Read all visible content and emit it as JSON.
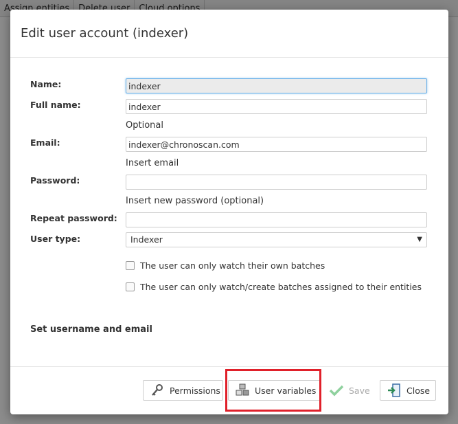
{
  "background": {
    "toolbar": [
      "Assign entities",
      "Delete user",
      "Cloud options"
    ]
  },
  "dialog": {
    "title": "Edit user account (indexer)",
    "fields": {
      "name_label": "Name:",
      "name_value": "indexer",
      "fullname_label": "Full name:",
      "fullname_value": "indexer",
      "fullname_hint": "Optional",
      "email_label": "Email:",
      "email_value": "indexer@chronoscan.com",
      "email_hint": "Insert email",
      "password_label": "Password:",
      "password_value": "",
      "password_hint": "Insert new password (optional)",
      "repeat_label": "Repeat password:",
      "repeat_value": "",
      "usertype_label": "User type:",
      "usertype_value": "Indexer"
    },
    "checkboxes": [
      {
        "label": "The user can only watch their own batches",
        "checked": false
      },
      {
        "label": "The user can only watch/create batches assigned to their entities",
        "checked": false
      }
    ],
    "section_title": "Set username and email",
    "buttons": {
      "permissions": "Permissions",
      "user_variables": "User variables",
      "save": "Save",
      "close": "Close"
    },
    "icons": {
      "permissions": "key-icon",
      "user_variables": "cubes-icon",
      "save": "checkmark-icon",
      "close": "exit-door-icon"
    },
    "colors": {
      "highlight": "#e0202a",
      "save_check": "#8fd19e"
    }
  }
}
